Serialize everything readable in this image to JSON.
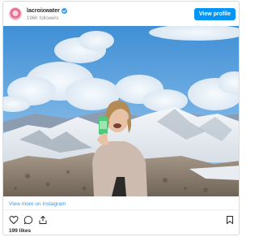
{
  "post": {
    "username": "lacroixwater",
    "followers": "196K followers",
    "view_profile_label": "View profile",
    "view_more_label": "View more on Instagram",
    "likes": "199 likes"
  },
  "icons": {
    "verified": "verified-badge-icon",
    "like": "heart-icon",
    "comment": "comment-icon",
    "share": "share-icon",
    "save": "bookmark-icon"
  },
  "colors": {
    "accent": "#0095f6",
    "link": "#3897f0",
    "muted": "#8e8e8e"
  }
}
